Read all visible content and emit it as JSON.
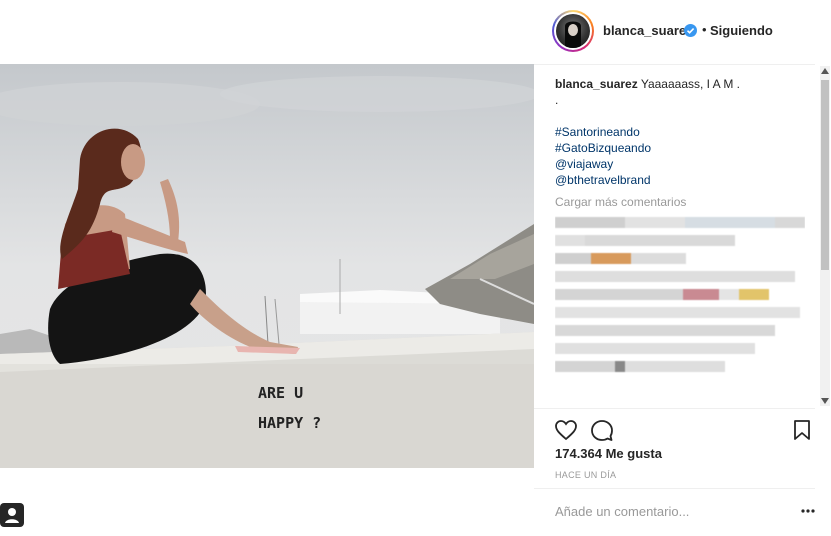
{
  "post": {
    "username": "blanca_suarez",
    "separator": "•",
    "follow_label": "Siguiendo",
    "caption_user": "blanca_suarez",
    "caption_text": "Yaaaaaass, I A M .",
    "caption_line2": ".",
    "tags": [
      "#Santorineando",
      "#GatoBizqueando",
      "@viajaway",
      "@bthetravelbrand"
    ],
    "load_more": "Cargar más comentarios",
    "likes": "174.364 Me gusta",
    "time": "HACE UN DÍA",
    "comment_placeholder": "Añade un comentario...",
    "photo_text_line1": "ARE  U",
    "photo_text_line2": "HAPPY  ?"
  },
  "icons": {
    "verified": "verified-badge-icon",
    "like": "heart-icon",
    "comment": "comment-bubble-icon",
    "save": "bookmark-icon",
    "options": "more-options-icon",
    "tag_user": "user-tag-icon"
  },
  "colors": {
    "link": "#003569",
    "verified": "#3897f0",
    "muted": "#999999",
    "text": "#262626"
  }
}
